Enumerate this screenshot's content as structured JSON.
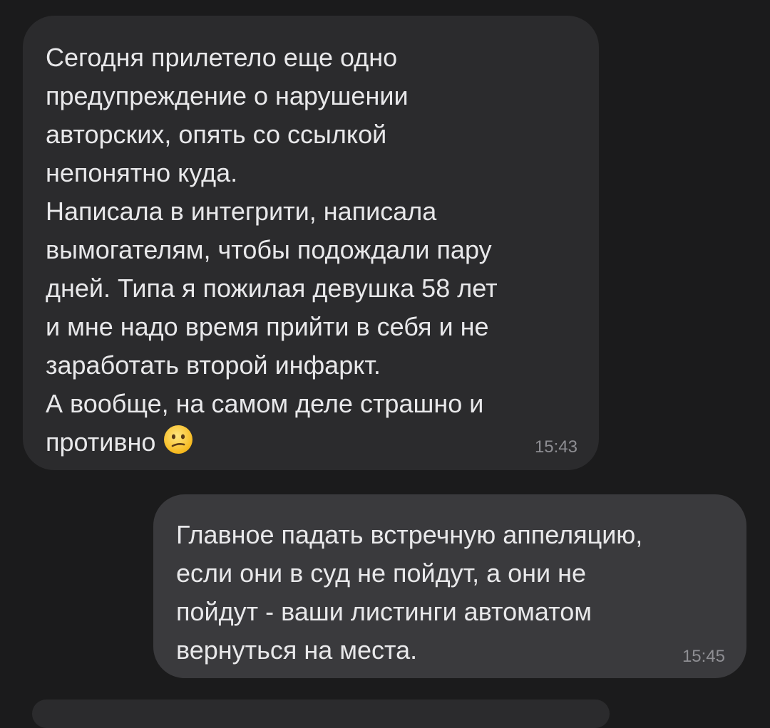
{
  "messages": [
    {
      "direction": "incoming",
      "lines": [
        "Сегодня прилетело еще одно",
        "предупреждение о нарушении",
        "авторских, опять со ссылкой",
        "непонятно куда.",
        "Написала в интегрити, написала",
        "вымогателям, чтобы подождали пару",
        "дней. Типа я пожилая девушка 58 лет",
        "и мне надо время прийти в себя и не",
        "заработать второй инфаркт.",
        "А вообще, на самом деле страшно и",
        "противно"
      ],
      "emoji": "confused-face",
      "time": "15:43"
    },
    {
      "direction": "outgoing",
      "lines": [
        "Главное падать встречную аппеляцию,",
        "если они в суд не пойдут, а они не",
        "пойдут - ваши листинги автоматом",
        "вернуться на места."
      ],
      "time": "15:45"
    }
  ],
  "colors": {
    "background": "#1b1b1c",
    "incoming_bubble": "#2b2b2d",
    "outgoing_bubble": "#3a3a3d",
    "text": "#e8e8ea",
    "timestamp": "#8e8e93"
  }
}
